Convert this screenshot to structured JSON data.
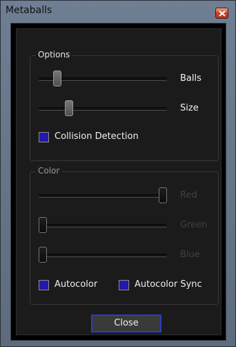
{
  "window": {
    "title": "Metaballs"
  },
  "options": {
    "legend": "Options",
    "sliders": [
      {
        "label": "Balls",
        "value": 0.12,
        "enabled": true
      },
      {
        "label": "Size",
        "value": 0.22,
        "enabled": true
      }
    ],
    "collision_label": "Collision Detection",
    "collision_checked": true
  },
  "color": {
    "legend": "Color",
    "sliders": [
      {
        "label": "Red",
        "value": 1.0,
        "enabled": false
      },
      {
        "label": "Green",
        "value": 0.0,
        "enabled": false
      },
      {
        "label": "Blue",
        "value": 0.0,
        "enabled": false
      }
    ],
    "autocolor_label": "Autocolor",
    "autocolor_checked": true,
    "autocolor_sync_label": "Autocolor Sync",
    "autocolor_sync_checked": true
  },
  "footer": {
    "close_label": "Close"
  },
  "colors": {
    "checkbox_fill": "#2318b0",
    "button_focus": "#2b3cc8"
  }
}
